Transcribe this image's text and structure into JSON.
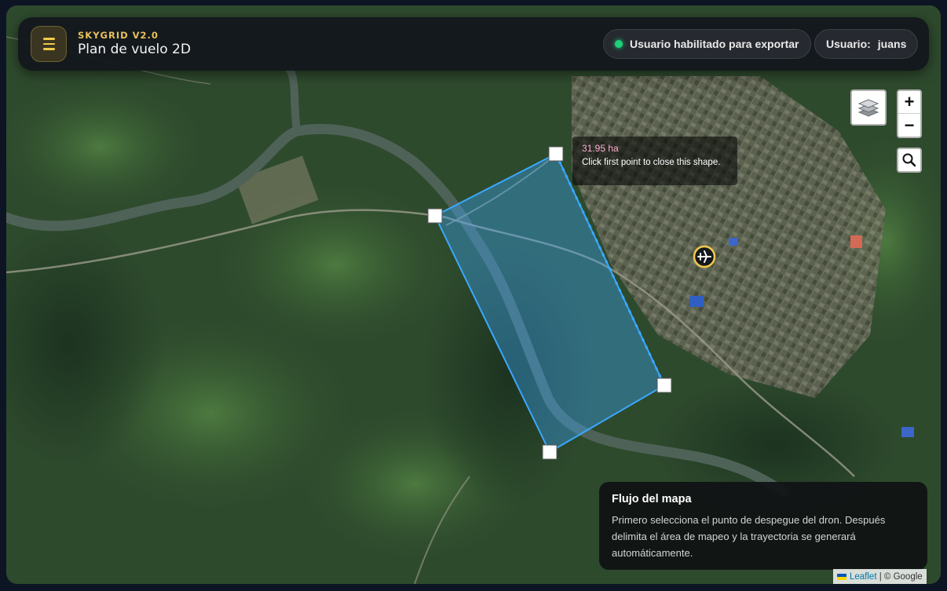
{
  "header": {
    "brand": "SKYGRID V2.0",
    "title": "Plan de vuelo 2D",
    "export_status": "Usuario habilitado para exportar",
    "user_label": "Usuario:",
    "user_name": "juans"
  },
  "map": {
    "zoom_in": "+",
    "zoom_out": "−",
    "layers_icon": "layers-icon",
    "search_icon": "search-icon",
    "takeoff_icon": "drone-takeoff-icon"
  },
  "draw_tooltip": {
    "area": "31.95 ha",
    "hint": "Click first point to close this shape."
  },
  "info_panel": {
    "title": "Flujo del mapa",
    "body": "Primero selecciona el punto de despegue del dron. Después delimita el área de mapeo y la trayectoria se generará automáticamente."
  },
  "attribution": {
    "leaflet": "Leaflet",
    "separator": " | ",
    "provider": "© Google"
  },
  "colors": {
    "accent": "#e8c15a",
    "status_ok": "#1ed07a",
    "polygon": "#3aa8ff"
  }
}
